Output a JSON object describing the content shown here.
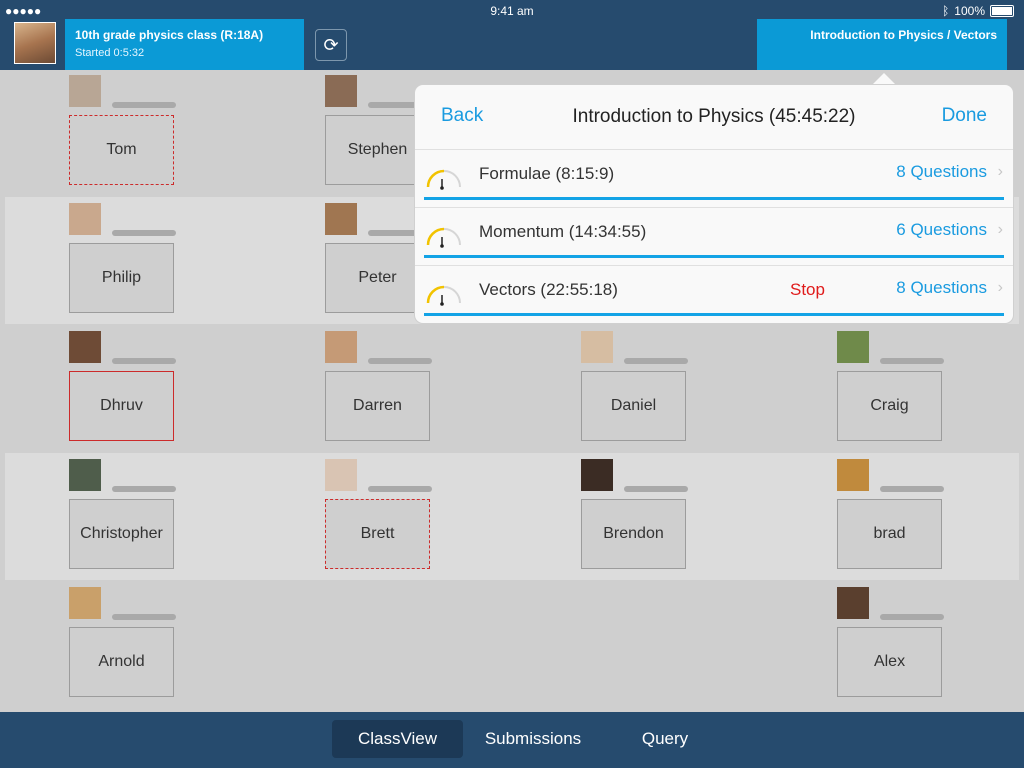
{
  "status_bar": {
    "signal": "●●●●●",
    "time": "9:41 am",
    "battery_pct": "100%"
  },
  "header": {
    "class_title": "10th grade physics class (R:18A)",
    "class_started": "Started 0:5:32",
    "topic_breadcrumb": "Introduction to Physics / Vectors"
  },
  "students": [
    {
      "name": "Tom"
    },
    {
      "name": "Stephen"
    },
    {
      "name": "Philip"
    },
    {
      "name": "Peter"
    },
    {
      "name": "Dhruv"
    },
    {
      "name": "Darren"
    },
    {
      "name": "Daniel"
    },
    {
      "name": "Craig"
    },
    {
      "name": "Christopher"
    },
    {
      "name": "Brett"
    },
    {
      "name": "Brendon"
    },
    {
      "name": "brad"
    },
    {
      "name": "Arnold"
    },
    {
      "name": "Alex"
    }
  ],
  "popover": {
    "back_label": "Back",
    "title": "Introduction to Physics (45:45:22)",
    "done_label": "Done",
    "rows": [
      {
        "label": "Formulae (8:15:9)",
        "questions": "8 Questions",
        "stop": ""
      },
      {
        "label": "Momentum (14:34:55)",
        "questions": "6 Questions",
        "stop": ""
      },
      {
        "label": "Vectors (22:55:18)",
        "questions": "8 Questions",
        "stop": "Stop"
      }
    ]
  },
  "tabs": [
    {
      "label": "ClassView",
      "active": true
    },
    {
      "label": "Submissions",
      "active": false
    },
    {
      "label": "Query",
      "active": false
    }
  ],
  "colors": {
    "header_bg": "#264b6e",
    "accent_blue": "#0b9ad6",
    "link_blue": "#1a9be0",
    "stop_red": "#e01b1b",
    "gauge_yellow": "#f2c300"
  }
}
